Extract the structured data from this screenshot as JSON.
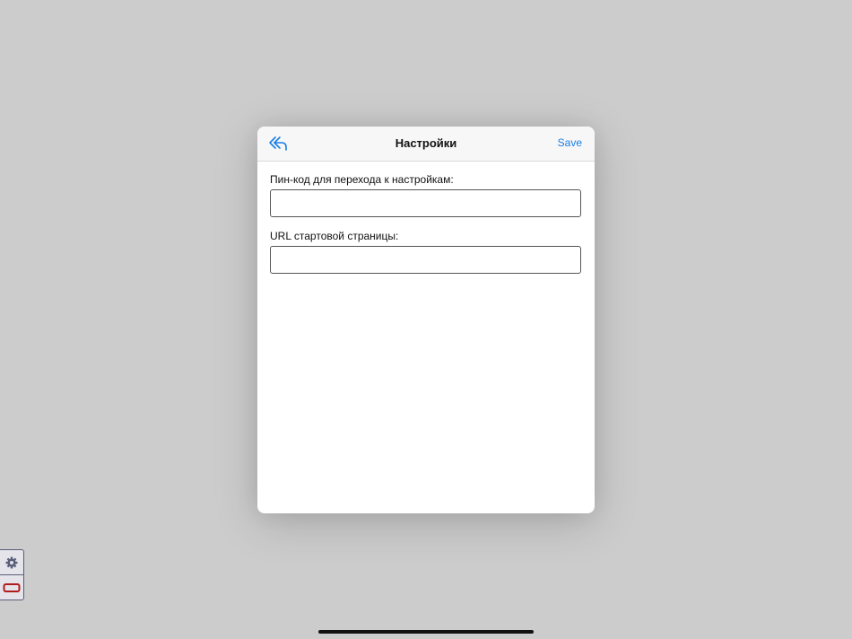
{
  "dialog": {
    "title": "Настройки",
    "save_label": "Save"
  },
  "fields": {
    "pin": {
      "label": "Пин-код для перехода к настройкам:",
      "value": "",
      "placeholder": ""
    },
    "start_url": {
      "label": "URL стартовой страницы:",
      "value": "",
      "placeholder": ""
    }
  },
  "icons": {
    "back": "reply-arrow-icon",
    "settings": "gear-icon",
    "exit": "rounded-rectangle-icon"
  },
  "colors": {
    "accent": "#1a7ee6",
    "background": "#cccccc",
    "exit_icon": "#b01b1b",
    "side_panel_border": "#5a5f7a"
  }
}
